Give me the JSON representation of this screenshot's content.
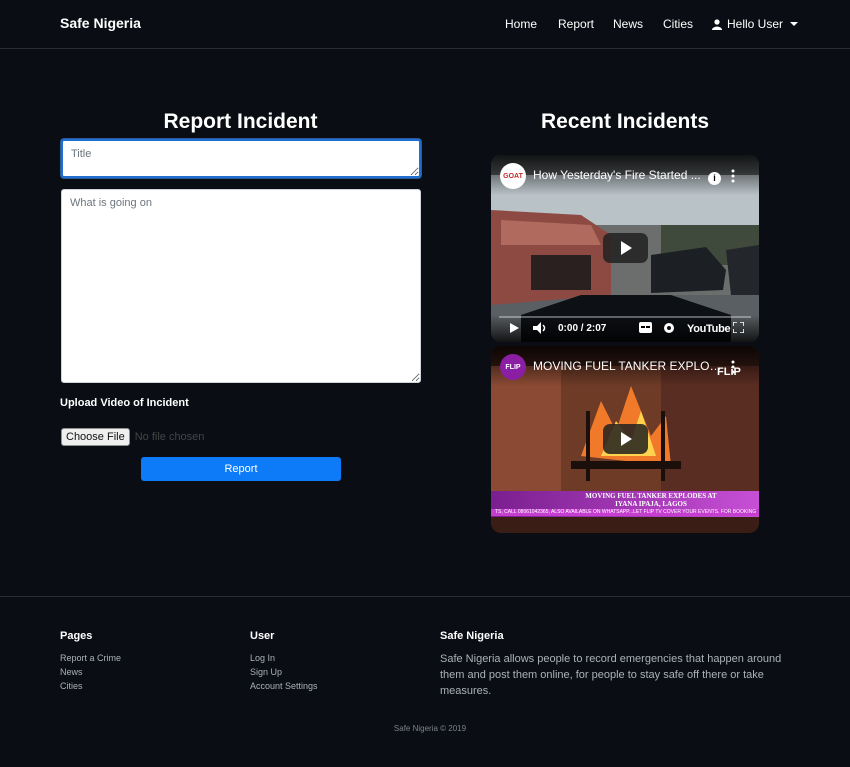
{
  "navbar": {
    "brand": "Safe Nigeria",
    "links": [
      "Home",
      "Report",
      "News",
      "Cities"
    ],
    "user_menu": "Hello User"
  },
  "report_form": {
    "heading": "Report Incident",
    "title_placeholder": "Title",
    "body_placeholder": "What is going on",
    "upload_label": "Upload Video of Incident",
    "file_button": "Choose File",
    "file_status": "No file chosen",
    "submit_label": "Report"
  },
  "recent": {
    "heading": "Recent Incidents",
    "videos": [
      {
        "title": "How Yesterday's Fire Started ...",
        "channel_logo_text": "GOAT",
        "time": "0:00 / 2:07",
        "brand": "YouTube",
        "info_icon": "info-icon",
        "more_icon": "more-vertical-icon"
      },
      {
        "title": "MOVING FUEL TANKER EXPLODES...",
        "channel_logo_text": "FLIP",
        "watermark": "FLiP",
        "banner_line1": "MOVING FUEL TANKER EXPLODES AT",
        "banner_line2": "IYANA IPAJA, LAGOS",
        "ticker": "TS, CALL 08061042365, ALSO AVAILABLE ON WHATSAPP...LET FLIP TV COVER YOUR EVENTS. FOR BOOKING"
      }
    ]
  },
  "footer": {
    "pages": {
      "heading": "Pages",
      "links": [
        "Report a Crime",
        "News",
        "Cities"
      ]
    },
    "user": {
      "heading": "User",
      "links": [
        "Log In",
        "Sign Up",
        "Account Settings"
      ]
    },
    "about": {
      "heading": "Safe Nigeria",
      "text": "Safe Nigeria allows people to record emergencies that happen around them and post them online, for people to stay safe off there or take measures."
    },
    "copyright": "Safe Nigeria © 2019"
  },
  "colors": {
    "background": "#0a0e14",
    "primary_button": "#0d7bf7",
    "muted_text": "#aab1b8"
  }
}
